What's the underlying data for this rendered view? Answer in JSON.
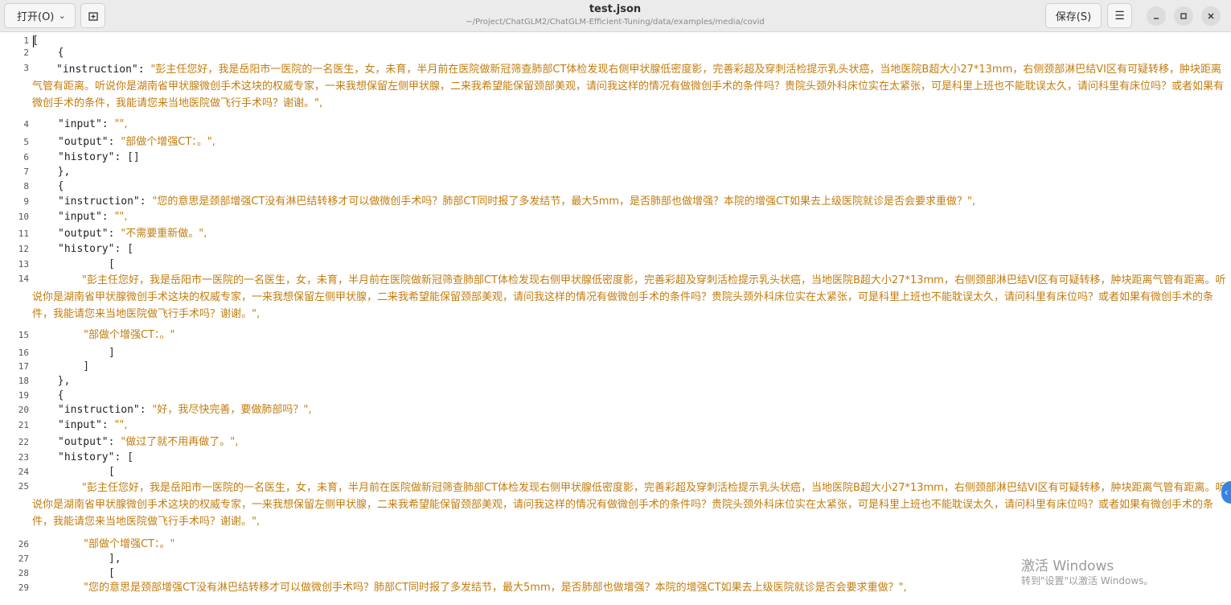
{
  "header": {
    "open_label": "打开(O)",
    "title": "test.json",
    "path": "~/Project/ChatGLM2/ChatGLM-Efficient-Tuning/data/examples/media/covid",
    "save_label": "保存(S)",
    "menu_icon": "☰"
  },
  "editor": {
    "lines": [
      {
        "n": "1",
        "text": "["
      },
      {
        "n": "2",
        "text": "  {"
      },
      {
        "n": "3",
        "key": "\"instruction\"",
        "value": "\"彭主任您好，我是岳阳市一医院的一名医生，女，未育，半月前在医院做新冠筛查肺部CT体检发现右侧甲状腺低密度影，完善彩超及穿刺活检提示乳头状癌，当地医院B超大小27*13mm，右侧颈部淋巴结VI区有可疑转移，肿块距离气管有距离。听说你是湖南省甲状腺微创手术这块的权威专家，一来我想保留左侧甲状腺，二来我希望能保留颈部美观，请问我这样的情况有做微创手术的条件吗？贵院头颈外科床位实在太紧张，可是科里上班也不能耽误太久，请问科里有床位吗？或者如果有微创手术的条件，我能请您来当地医院做飞行手术吗？谢谢。\","
      },
      {
        "n": "4",
        "key": "\"input\"",
        "value": "\"\","
      },
      {
        "n": "5",
        "key": "\"output\"",
        "value": "\"部做个增强CT：。\","
      },
      {
        "n": "6",
        "key": "\"history\"",
        "plain": ": []"
      },
      {
        "n": "7",
        "text": "  },"
      },
      {
        "n": "8",
        "text": "  {"
      },
      {
        "n": "9",
        "key": "\"instruction\"",
        "value": "\"您的意思是颈部增强CT没有淋巴结转移才可以做微创手术吗？肺部CT同时报了多发结节，最大5mm，是否肺部也做增强？本院的增强CT如果去上级医院就诊是否会要求重做？\","
      },
      {
        "n": "10",
        "key": "\"input\"",
        "value": "\"\","
      },
      {
        "n": "11",
        "key": "\"output\"",
        "value": "\"不需要重新做。\","
      },
      {
        "n": "12",
        "key": "\"history\"",
        "plain": ": ["
      },
      {
        "n": "13",
        "text": "      ["
      },
      {
        "n": "14",
        "value": "\"彭主任您好，我是岳阳市一医院的一名医生，女，未育，半月前在医院做新冠筛查肺部CT体检发现右侧甲状腺低密度影，完善彩超及穿刺活检提示乳头状癌，当地医院B超大小27*13mm，右侧颈部淋巴结VI区有可疑转移，肿块距离气管有距离。听说你是湖南省甲状腺微创手术这块的权威专家，一来我想保留左侧甲状腺，二来我希望能保留颈部美观，请问我这样的情况有做微创手术的条件吗？贵院头颈外科床位实在太紧张，可是科里上班也不能耽误太久，请问科里有床位吗？或者如果有微创手术的条件，我能请您来当地医院做飞行手术吗？谢谢。\","
      },
      {
        "n": "15",
        "value": "\"部做个增强CT：。\""
      },
      {
        "n": "16",
        "text": "      ]"
      },
      {
        "n": "17",
        "text": "    ]"
      },
      {
        "n": "18",
        "text": "  },"
      },
      {
        "n": "19",
        "text": "  {"
      },
      {
        "n": "20",
        "key": "\"instruction\"",
        "value": "\"好，我尽快完善，要做肺部吗？\","
      },
      {
        "n": "21",
        "key": "\"input\"",
        "value": "\"\","
      },
      {
        "n": "22",
        "key": "\"output\"",
        "value": "\"做过了就不用再做了。\","
      },
      {
        "n": "23",
        "key": "\"history\"",
        "plain": ": ["
      },
      {
        "n": "24",
        "text": "      ["
      },
      {
        "n": "25",
        "value": "\"彭主任您好，我是岳阳市一医院的一名医生，女，未育，半月前在医院做新冠筛查肺部CT体检发现右侧甲状腺低密度影，完善彩超及穿刺活检提示乳头状癌，当地医院B超大小27*13mm，右侧颈部淋巴结VI区有可疑转移，肿块距离气管有距离。听说你是湖南省甲状腺微创手术这块的权威专家，一来我想保留左侧甲状腺，二来我希望能保留颈部美观，请问我这样的情况有做微创手术的条件吗？贵院头颈外科床位实在太紧张，可是科里上班也不能耽误太久，请问科里有床位吗？或者如果有微创手术的条件，我能请您来当地医院做飞行手术吗？谢谢。\","
      },
      {
        "n": "26",
        "value": "\"部做个增强CT：。\""
      },
      {
        "n": "27",
        "text": "      ],"
      },
      {
        "n": "28",
        "text": "      ["
      },
      {
        "n": "29",
        "value": "\"您的意思是颈部增强CT没有淋巴结转移才可以做微创手术吗？肺部CT同时报了多发结节，最大5mm，是否肺部也做增强？本院的增强CT如果去上级医院就诊是否会要求重做？\","
      }
    ]
  },
  "watermark": {
    "line1": "激活 Windows",
    "line2": "转到\"设置\"以激活 Windows。"
  }
}
